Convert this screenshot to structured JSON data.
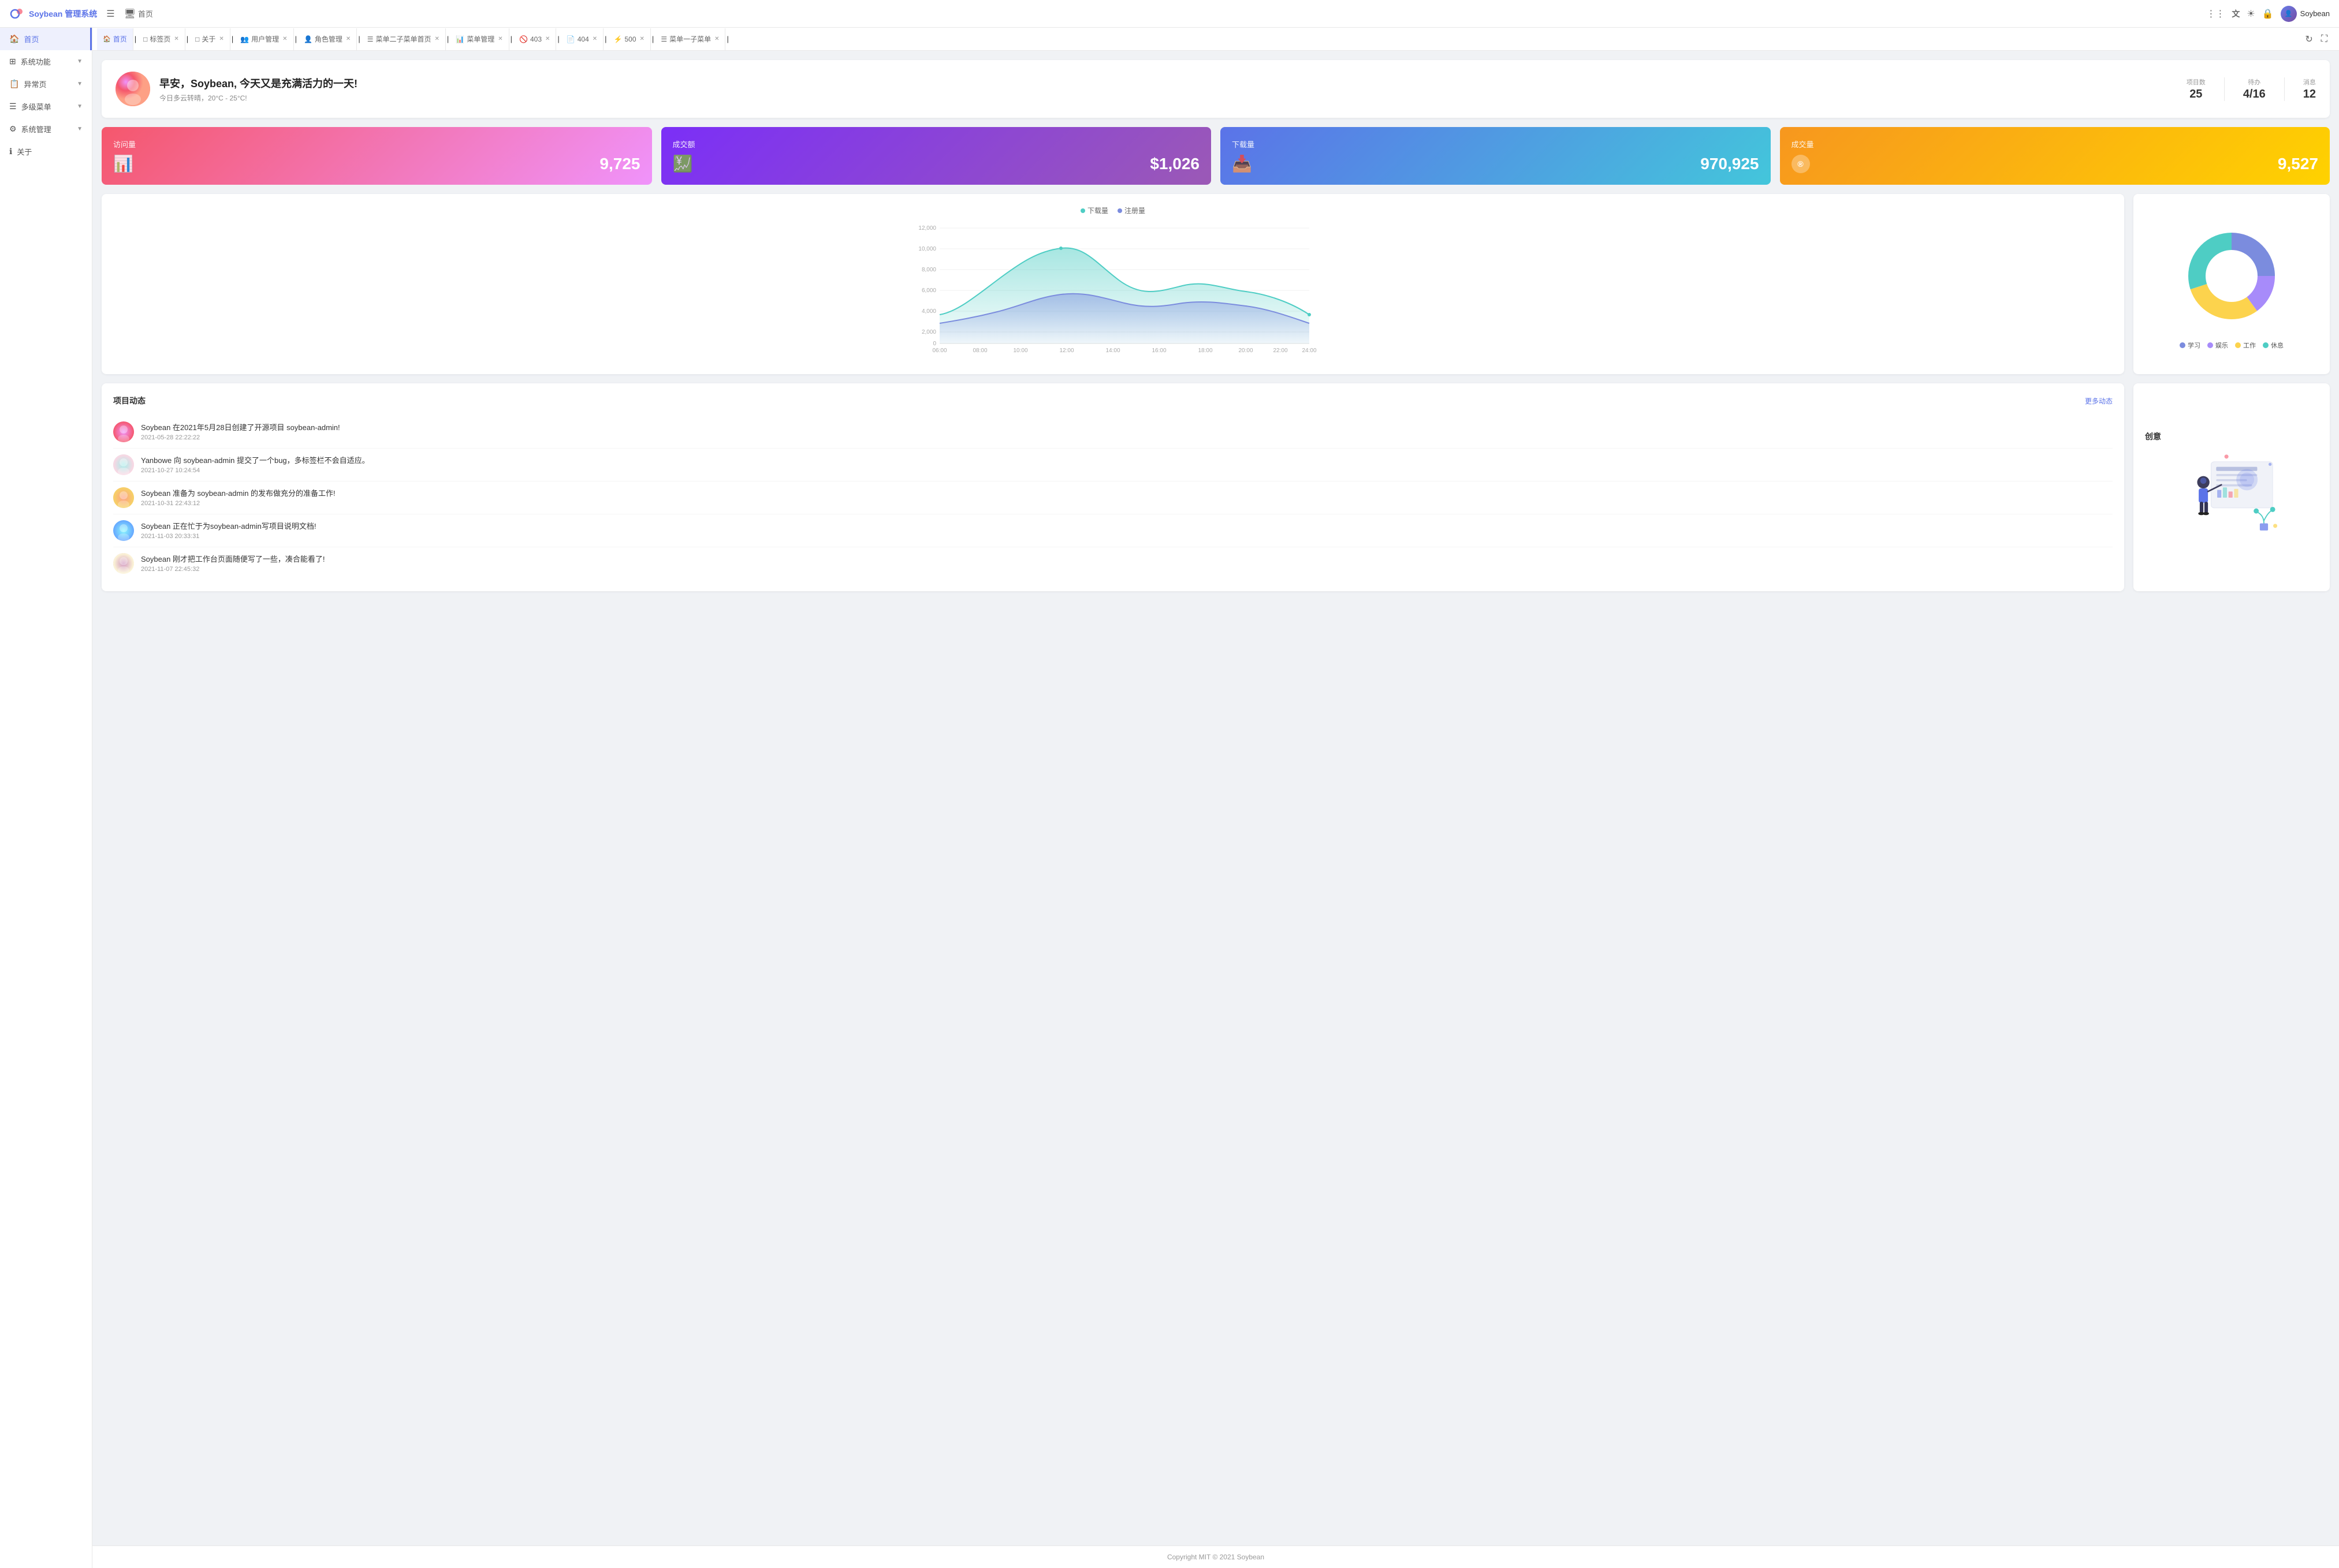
{
  "app": {
    "logo_text": "Soybean 管理系统",
    "user_name": "Soybean"
  },
  "top_nav": {
    "menu_icon": "☰",
    "home_label": "首页",
    "grid_icon": "⋮⋮",
    "sun_icon": "☀",
    "translate_icon": "A",
    "screen_icon": "⬜",
    "refresh_icon": "↻",
    "fullscreen_icon": "⛶"
  },
  "sidebar": {
    "items": [
      {
        "id": "home",
        "label": "首页",
        "icon": "🏠",
        "active": true,
        "has_arrow": false
      },
      {
        "id": "system",
        "label": "系统功能",
        "icon": "⊞",
        "active": false,
        "has_arrow": true
      },
      {
        "id": "exception",
        "label": "异常页",
        "icon": "📋",
        "active": false,
        "has_arrow": true
      },
      {
        "id": "multi-menu",
        "label": "多级菜单",
        "icon": "☰",
        "active": false,
        "has_arrow": true
      },
      {
        "id": "sys-manage",
        "label": "系统管理",
        "icon": "⚙",
        "active": false,
        "has_arrow": true
      },
      {
        "id": "about",
        "label": "关于",
        "icon": "ℹ",
        "active": false,
        "has_arrow": false
      }
    ]
  },
  "tabs": [
    {
      "label": "首页",
      "icon": "🏠",
      "closable": false,
      "active": true
    },
    {
      "label": "标签页",
      "icon": "□",
      "closable": true,
      "active": false
    },
    {
      "label": "关于",
      "icon": "□",
      "closable": true,
      "active": false
    },
    {
      "label": "用户管理",
      "icon": "👥",
      "closable": true,
      "active": false
    },
    {
      "label": "角色管理",
      "icon": "👤",
      "closable": true,
      "active": false
    },
    {
      "label": "菜单二子菜单首页",
      "icon": "☰",
      "closable": true,
      "active": false
    },
    {
      "label": "菜单管理",
      "icon": "📊",
      "closable": true,
      "active": false
    },
    {
      "label": "403",
      "icon": "🚫",
      "closable": true,
      "active": false
    },
    {
      "label": "404",
      "icon": "📄",
      "closable": true,
      "active": false
    },
    {
      "label": "500",
      "icon": "⚡",
      "closable": true,
      "active": false
    },
    {
      "label": "菜单一子菜单",
      "icon": "☰",
      "closable": true,
      "active": false
    }
  ],
  "welcome": {
    "greeting": "早安，Soybean, 今天又是充满活力的一天!",
    "weather": "今日多云转晴，20°C - 25°C!",
    "stats": {
      "projects_label": "项目数",
      "projects_value": "25",
      "todo_label": "待办",
      "todo_value": "4/16",
      "messages_label": "消息",
      "messages_value": "12"
    }
  },
  "metrics": [
    {
      "id": "visits",
      "title": "访问量",
      "value": "9,725",
      "icon": "📊"
    },
    {
      "id": "revenue",
      "title": "成交额",
      "value": "$1,026",
      "icon": "💹"
    },
    {
      "id": "downloads",
      "title": "下载量",
      "value": "970,925",
      "icon": "📥"
    },
    {
      "id": "transactions",
      "title": "成交量",
      "value": "9,527",
      "icon": "®"
    }
  ],
  "line_chart": {
    "legend": [
      "下载量",
      "注册量"
    ],
    "colors": [
      "#4ecdc4",
      "#7b8cde"
    ],
    "x_labels": [
      "06:00",
      "08:00",
      "10:00",
      "12:00",
      "14:00",
      "16:00",
      "18:00",
      "20:00",
      "22:00",
      "24:00"
    ],
    "y_labels": [
      "0",
      "2,000",
      "4,000",
      "6,000",
      "8,000",
      "10,000",
      "12,000"
    ]
  },
  "donut_chart": {
    "segments": [
      {
        "label": "学习",
        "color": "#7b8cde",
        "value": 25
      },
      {
        "label": "娱乐",
        "color": "#a78bfa",
        "value": 15
      },
      {
        "label": "工作",
        "color": "#fcd34d",
        "value": 30
      },
      {
        "label": "休息",
        "color": "#4ecdc4",
        "value": 30
      }
    ]
  },
  "activities": {
    "title": "项目动态",
    "more_label": "更多动态",
    "items": [
      {
        "text": "Soybean 在2021年5月28日创建了开源项目 soybean-admin!",
        "time": "2021-05-28 22:22:22"
      },
      {
        "text": "Yanbowe 向 soybean-admin 提交了一个bug，多标签栏不会自适应。",
        "time": "2021-10-27 10:24:54"
      },
      {
        "text": "Soybean 准备为 soybean-admin 的发布做充分的准备工作!",
        "time": "2021-10-31 22:43:12"
      },
      {
        "text": "Soybean 正在忙于为soybean-admin写项目说明文档!",
        "time": "2021-11-03 20:33:31"
      },
      {
        "text": "Soybean 刚才把工作台页面随便写了一些，凑合能看了!",
        "time": "2021-11-07 22:45:32"
      }
    ]
  },
  "creative": {
    "title": "创意"
  },
  "footer": {
    "text": "Copyright MIT © 2021 Soybean"
  }
}
